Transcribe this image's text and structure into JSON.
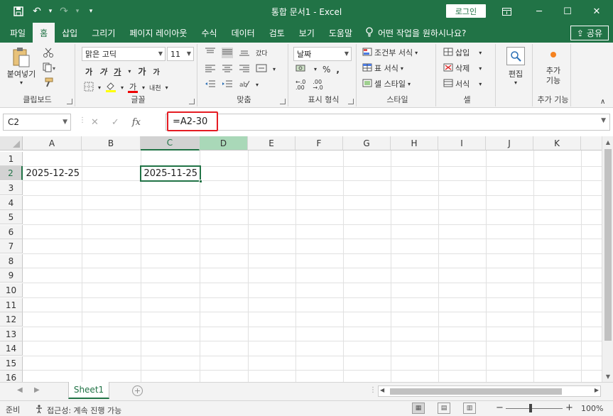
{
  "window": {
    "title": "통합 문서1  -  Excel",
    "login_label": "로그인",
    "controls": {
      "restore_icon": "ribbon-display-icon",
      "minimize": "─",
      "maximize": "☐",
      "close": "✕"
    }
  },
  "quick_access": {
    "save": "💾",
    "undo": "↶",
    "redo": "↷",
    "customize": "▾"
  },
  "tabs": [
    {
      "label": "파일"
    },
    {
      "label": "홈"
    },
    {
      "label": "삽입"
    },
    {
      "label": "그리기"
    },
    {
      "label": "페이지 레이아웃"
    },
    {
      "label": "수식"
    },
    {
      "label": "데이터"
    },
    {
      "label": "검토"
    },
    {
      "label": "보기"
    },
    {
      "label": "도움말"
    }
  ],
  "tell_me": "어떤 작업을 원하시나요?",
  "share_label": "공유",
  "ribbon": {
    "clipboard": {
      "label": "클립보드",
      "paste": "붙여넣기"
    },
    "font": {
      "label": "글꼴",
      "font_name": "맑은 고딕",
      "font_size": "11",
      "bold": "가",
      "italic": "가",
      "underline": "가",
      "grow": "가",
      "shrink": "가",
      "color": "가",
      "phonetic": "내천"
    },
    "alignment": {
      "label": "맞춤",
      "wrap": "갔다"
    },
    "number": {
      "label": "표시 형식",
      "format": "날짜"
    },
    "styles": {
      "label": "스타일",
      "conditional": "조건부 서식",
      "table": "표 서식",
      "cell_styles": "셀 스타일"
    },
    "cells": {
      "label": "셀",
      "insert": "삽입",
      "delete": "삭제",
      "format": "서식"
    },
    "editing": {
      "label": "편집"
    },
    "addins": {
      "label": "추가 기능",
      "button": "추가\n기능"
    }
  },
  "formula_bar": {
    "name_box": "C2",
    "cancel": "✕",
    "enter": "✓",
    "fx": "fx",
    "formula": "=A2-30"
  },
  "grid": {
    "columns": [
      "A",
      "B",
      "C",
      "D",
      "E",
      "F",
      "G",
      "H",
      "I",
      "J",
      "K"
    ],
    "rows": [
      "1",
      "2",
      "3",
      "4",
      "5",
      "6",
      "7",
      "8",
      "9",
      "10",
      "11",
      "12",
      "13",
      "14",
      "15",
      "16"
    ],
    "cells": {
      "A2": "2025-12-25",
      "C2": "2025-11-25"
    },
    "active_cell": "C2"
  },
  "sheets": [
    {
      "name": "Sheet1"
    }
  ],
  "status": {
    "ready": "준비",
    "accessibility": "접근성: 계속 진행 가능",
    "zoom": "100%",
    "zoom_minus": "−",
    "zoom_plus": "+"
  },
  "colors": {
    "brand": "#217346",
    "highlight_box": "#e51c23"
  }
}
